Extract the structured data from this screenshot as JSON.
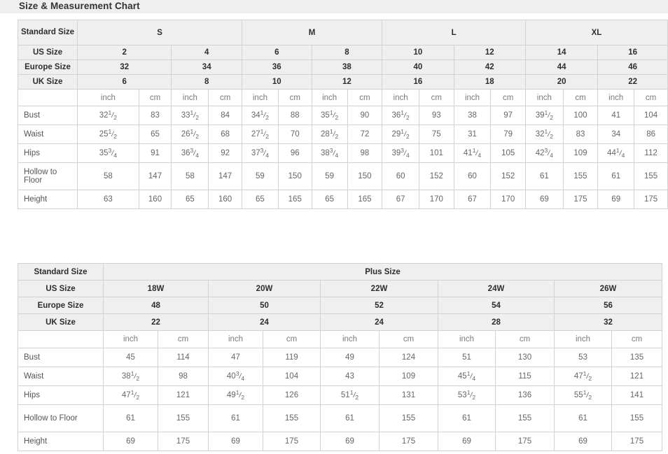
{
  "header": {
    "title": "Size & Measurement Chart"
  },
  "standard_chart": {
    "label_standard_size": "Standard Size",
    "label_us_size": "US Size",
    "label_europe_size": "Europe Size",
    "label_uk_size": "UK Size",
    "groups": [
      "S",
      "M",
      "L",
      "XL"
    ],
    "us_sizes": [
      "2",
      "4",
      "6",
      "8",
      "10",
      "12",
      "14",
      "16"
    ],
    "europe_sizes": [
      "32",
      "34",
      "36",
      "38",
      "40",
      "42",
      "44",
      "46"
    ],
    "uk_sizes": [
      "6",
      "8",
      "10",
      "12",
      "16",
      "18",
      "20",
      "22"
    ],
    "unit_inch": "inch",
    "unit_cm": "cm",
    "measurements": [
      {
        "name": "Bust",
        "values": [
          {
            "whole": "32",
            "num": "1",
            "den": "2"
          },
          "83",
          {
            "whole": "33",
            "num": "1",
            "den": "2"
          },
          "84",
          {
            "whole": "34",
            "num": "1",
            "den": "2"
          },
          "88",
          {
            "whole": "35",
            "num": "1",
            "den": "2"
          },
          "90",
          {
            "whole": "36",
            "num": "1",
            "den": "2"
          },
          "93",
          "38",
          "97",
          {
            "whole": "39",
            "num": "1",
            "den": "2"
          },
          "100",
          "41",
          "104"
        ]
      },
      {
        "name": "Waist",
        "values": [
          {
            "whole": "25",
            "num": "1",
            "den": "2"
          },
          "65",
          {
            "whole": "26",
            "num": "1",
            "den": "2"
          },
          "68",
          {
            "whole": "27",
            "num": "1",
            "den": "2"
          },
          "70",
          {
            "whole": "28",
            "num": "1",
            "den": "2"
          },
          "72",
          {
            "whole": "29",
            "num": "1",
            "den": "2"
          },
          "75",
          "31",
          "79",
          {
            "whole": "32",
            "num": "1",
            "den": "2"
          },
          "83",
          "34",
          "86"
        ]
      },
      {
        "name": "Hips",
        "values": [
          {
            "whole": "35",
            "num": "3",
            "den": "4"
          },
          "91",
          {
            "whole": "36",
            "num": "3",
            "den": "4"
          },
          "92",
          {
            "whole": "37",
            "num": "3",
            "den": "4"
          },
          "96",
          {
            "whole": "38",
            "num": "3",
            "den": "4"
          },
          "98",
          {
            "whole": "39",
            "num": "3",
            "den": "4"
          },
          "101",
          {
            "whole": "41",
            "num": "1",
            "den": "4"
          },
          "105",
          {
            "whole": "42",
            "num": "3",
            "den": "4"
          },
          "109",
          {
            "whole": "44",
            "num": "1",
            "den": "4"
          },
          "112"
        ]
      },
      {
        "name": "Hollow to Floor",
        "values": [
          "58",
          "147",
          "58",
          "147",
          "59",
          "150",
          "59",
          "150",
          "60",
          "152",
          "60",
          "152",
          "61",
          "155",
          "61",
          "155"
        ]
      },
      {
        "name": "Height",
        "values": [
          "63",
          "160",
          "65",
          "160",
          "65",
          "165",
          "65",
          "165",
          "67",
          "170",
          "67",
          "170",
          "69",
          "175",
          "69",
          "175"
        ]
      }
    ]
  },
  "plus_chart": {
    "label_standard_size": "Standard Size",
    "label_us_size": "US Size",
    "label_europe_size": "Europe Size",
    "label_uk_size": "UK Size",
    "group": "Plus Size",
    "us_sizes": [
      "18W",
      "20W",
      "22W",
      "24W",
      "26W"
    ],
    "europe_sizes": [
      "48",
      "50",
      "52",
      "54",
      "56"
    ],
    "uk_sizes": [
      "22",
      "24",
      "24",
      "28",
      "32"
    ],
    "unit_inch": "inch",
    "unit_cm": "cm",
    "measurements": [
      {
        "name": "Bust",
        "values": [
          "45",
          "114",
          "47",
          "119",
          "49",
          "124",
          "51",
          "130",
          "53",
          "135"
        ]
      },
      {
        "name": "Waist",
        "values": [
          {
            "whole": "38",
            "num": "1",
            "den": "2"
          },
          "98",
          {
            "whole": "40",
            "num": "3",
            "den": "4"
          },
          "104",
          "43",
          "109",
          {
            "whole": "45",
            "num": "1",
            "den": "4"
          },
          "115",
          {
            "whole": "47",
            "num": "1",
            "den": "2"
          },
          "121"
        ]
      },
      {
        "name": "Hips",
        "values": [
          {
            "whole": "47",
            "num": "1",
            "den": "2"
          },
          "121",
          {
            "whole": "49",
            "num": "1",
            "den": "2"
          },
          "126",
          {
            "whole": "51",
            "num": "1",
            "den": "2"
          },
          "131",
          {
            "whole": "53",
            "num": "1",
            "den": "2"
          },
          "136",
          {
            "whole": "55",
            "num": "1",
            "den": "2"
          },
          "141"
        ]
      },
      {
        "name": "Hollow to Floor",
        "values": [
          "61",
          "155",
          "61",
          "155",
          "61",
          "155",
          "61",
          "155",
          "61",
          "155"
        ]
      },
      {
        "name": "Height",
        "values": [
          "69",
          "175",
          "69",
          "175",
          "69",
          "175",
          "69",
          "175",
          "69",
          "175"
        ]
      }
    ]
  },
  "colors": {
    "header_band": "#efefef",
    "border": "#d2d2d2",
    "text_dark": "#2e2e2e",
    "text_body": "#666666"
  }
}
